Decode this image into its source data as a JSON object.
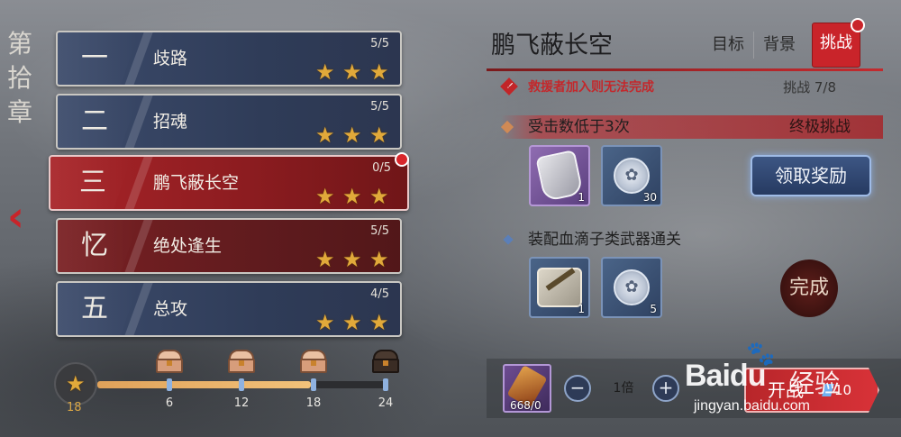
{
  "chapter": {
    "title_chars": [
      "第",
      "拾",
      "章"
    ]
  },
  "nav": {
    "back_glyph": "‹"
  },
  "stages": [
    {
      "num": "一",
      "name": "歧路",
      "progress": "5/5",
      "stars": 3,
      "state": "normal",
      "theme": "blue"
    },
    {
      "num": "二",
      "name": "招魂",
      "progress": "5/5",
      "stars": 3,
      "state": "normal",
      "theme": "blue"
    },
    {
      "num": "三",
      "name": "鹏飞蔽长空",
      "progress": "0/5",
      "stars": 3,
      "state": "active",
      "theme": "red",
      "has_alert": true
    },
    {
      "num": "忆",
      "name": "绝处逢生",
      "progress": "5/5",
      "stars": 3,
      "state": "normal",
      "theme": "red"
    },
    {
      "num": "五",
      "name": "总攻",
      "progress": "4/5",
      "stars": 3,
      "state": "normal",
      "theme": "blue"
    }
  ],
  "star_track": {
    "current": "18",
    "progress_fraction": 0.74,
    "milestones": [
      {
        "value": "6",
        "chest": "bronze-chest-icon",
        "opened": true
      },
      {
        "value": "12",
        "chest": "bronze-chest-icon",
        "opened": true
      },
      {
        "value": "18",
        "chest": "bronze-chest-icon",
        "opened": true
      },
      {
        "value": "24",
        "chest": "dark-chest-icon",
        "opened": false
      }
    ]
  },
  "detail": {
    "title": "鹏飞蔽长空",
    "tabs": [
      "目标",
      "背景",
      "挑战"
    ],
    "active_tab": "挑战",
    "warning": "救援者加入则无法完成",
    "challenge_count": "挑战  7/8",
    "goals": [
      {
        "text": "受击数低于3次",
        "tag": "终极挑战",
        "rewards": [
          {
            "icon": "silver-badge-icon",
            "qty": "1",
            "rarity": "purple"
          },
          {
            "icon": "silver-coin-icon",
            "qty": "30",
            "rarity": "blue"
          }
        ],
        "action": "领取奖励"
      },
      {
        "text": "装配血滴子类武器通关",
        "rewards": [
          {
            "icon": "puzzle-piece-icon",
            "qty": "1",
            "rarity": "blue"
          },
          {
            "icon": "silver-coin-icon",
            "qty": "5",
            "rarity": "blue"
          }
        ],
        "status": "完成"
      }
    ]
  },
  "bottom_bar": {
    "item_count": "668/0",
    "multiplier": "1倍",
    "minus": "−",
    "plus": "+",
    "start_label": "开战",
    "start_cost": "10"
  },
  "watermark": {
    "brand": "Bai",
    "brand_du": "du",
    "cn": "经验",
    "url": "jingyan.baidu.com"
  },
  "colors": {
    "accent_red": "#c9242a",
    "star_gold": "#e1a93a",
    "panel_blue": "#2f3c58"
  }
}
